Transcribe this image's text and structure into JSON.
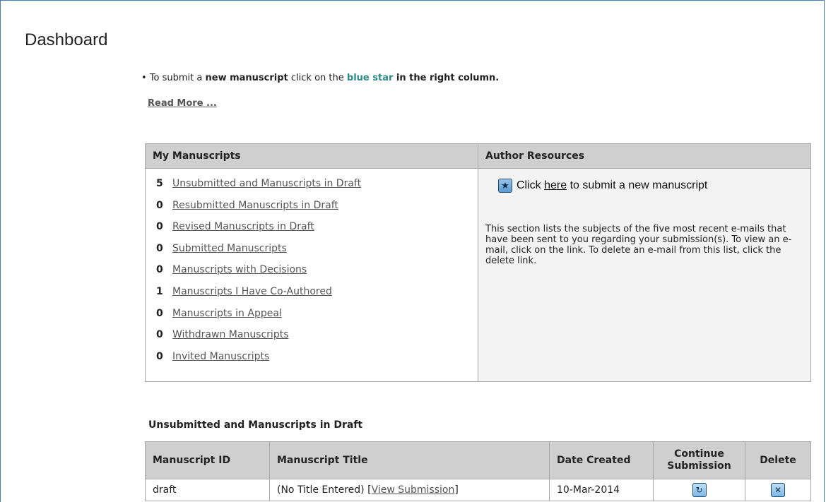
{
  "page": {
    "title": "Dashboard",
    "intro": {
      "bullet": "•",
      "p1": "To submit a ",
      "b1": "new manuscript",
      "p2": " click on the ",
      "accent": "blue star",
      "b2": " in the right column."
    },
    "read_more": "Read More ..."
  },
  "my_manuscripts": {
    "header": "My Manuscripts",
    "items": [
      {
        "count": "5",
        "label": "Unsubmitted and Manuscripts in Draft"
      },
      {
        "count": "0",
        "label": "Resubmitted Manuscripts in Draft"
      },
      {
        "count": "0",
        "label": "Revised Manuscripts in Draft"
      },
      {
        "count": "0",
        "label": "Submitted Manuscripts"
      },
      {
        "count": "0",
        "label": "Manuscripts with Decisions"
      },
      {
        "count": "1",
        "label": "Manuscripts I Have Co-Authored"
      },
      {
        "count": "0",
        "label": "Manuscripts in Appeal"
      },
      {
        "count": "0",
        "label": "Withdrawn Manuscripts"
      },
      {
        "count": "0",
        "label": "Invited Manuscripts"
      }
    ]
  },
  "author_resources": {
    "header": "Author Resources",
    "submit_prefix": "Click ",
    "submit_link": "here",
    "submit_suffix": " to submit a new manuscript",
    "description": "This section lists the subjects of the five most recent e-mails that have been sent to you regarding your submission(s). To view an e-mail, click on the link. To delete an e-mail from this list, click the delete link."
  },
  "drafts": {
    "title": "Unsubmitted and Manuscripts in Draft",
    "columns": {
      "id": "Manuscript ID",
      "title": "Manuscript Title",
      "date": "Date Created",
      "continue": "Continue Submission",
      "delete": "Delete"
    },
    "rows": [
      {
        "id": "draft",
        "title": "(No Title Entered)",
        "view_open": " [",
        "view_label": "View Submission",
        "view_close": "]",
        "date": "10-Mar-2014"
      }
    ]
  },
  "icons": {
    "star": "star-icon",
    "continue": "continue-icon",
    "delete": "delete-icon"
  },
  "colors": {
    "accent": "#2b8a8a",
    "header_bg": "#cfcfcf",
    "resources_bg": "#f3f3f3"
  }
}
